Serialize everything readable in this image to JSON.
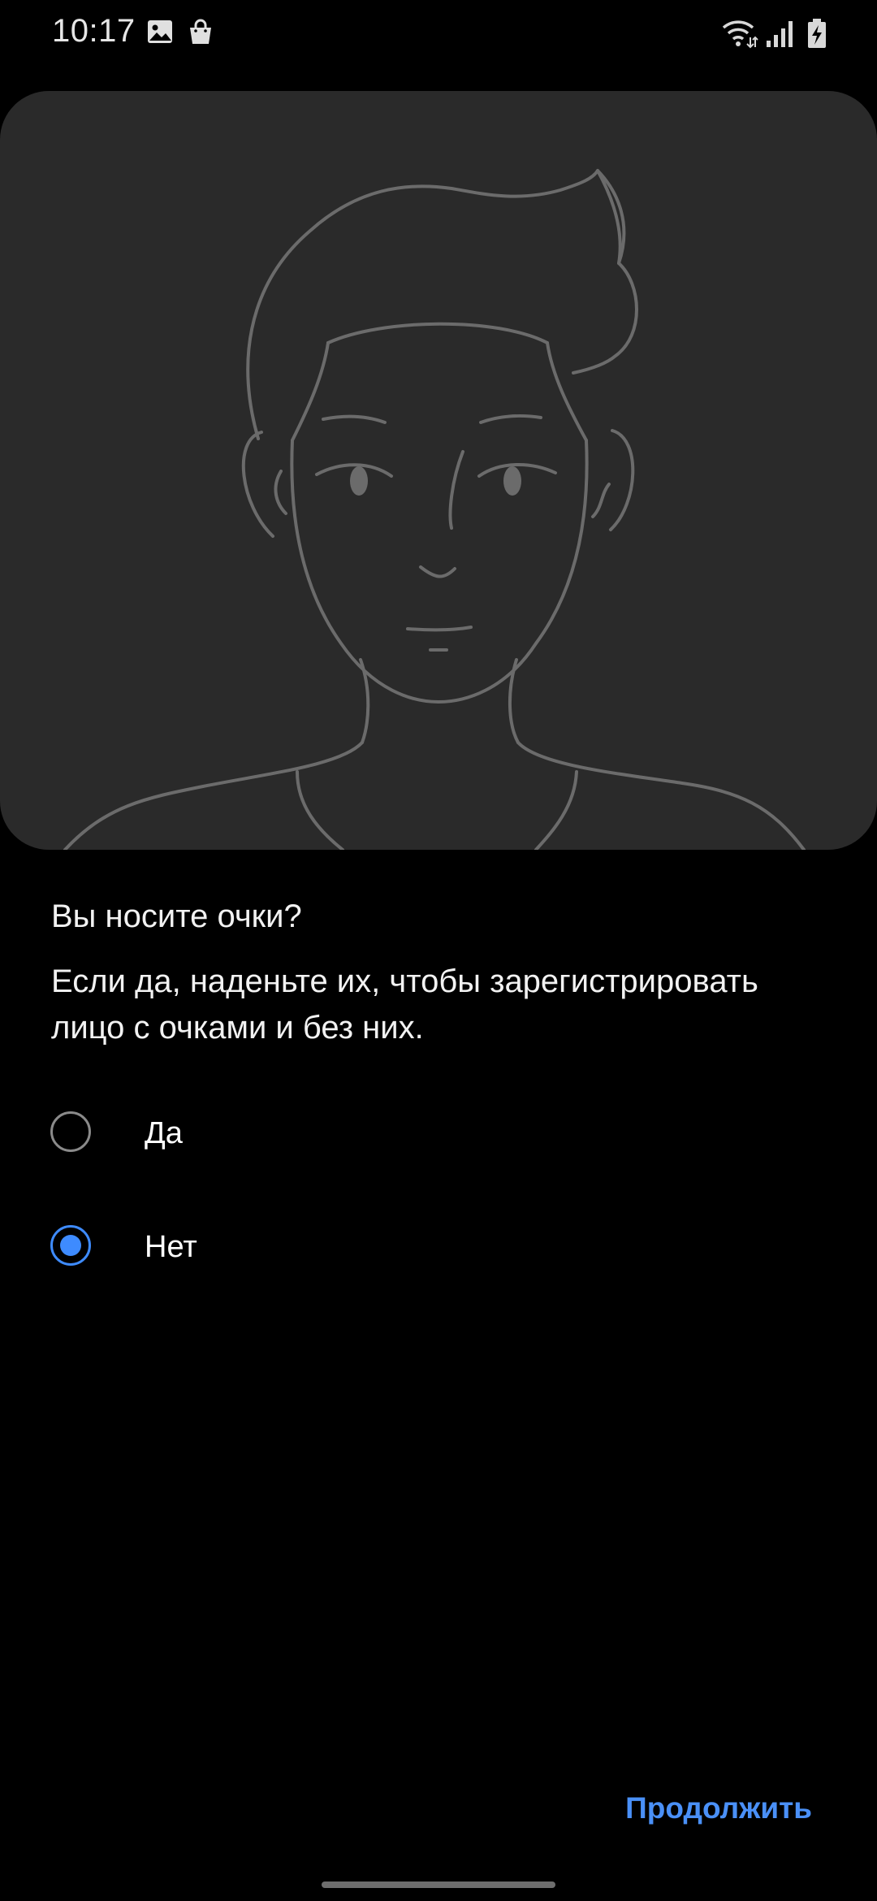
{
  "status_bar": {
    "time": "10:17",
    "left_icons": [
      "gallery-icon",
      "shopping-bag-icon"
    ],
    "right_icons": [
      "wifi-icon",
      "signal-icon",
      "battery-charging-icon"
    ]
  },
  "illustration": {
    "subject": "face-outline",
    "background_color": "#2a2a2a",
    "line_color": "#6b6b6b"
  },
  "question": {
    "title": "Вы носите очки?",
    "description": "Если да, наденьте их, чтобы зарегистрировать лицо с очками и без них."
  },
  "options": [
    {
      "label": "Да",
      "selected": false
    },
    {
      "label": "Нет",
      "selected": true
    }
  ],
  "actions": {
    "continue_label": "Продолжить"
  },
  "colors": {
    "accent": "#3e8bff",
    "background": "#000000",
    "text": "#ffffff"
  }
}
